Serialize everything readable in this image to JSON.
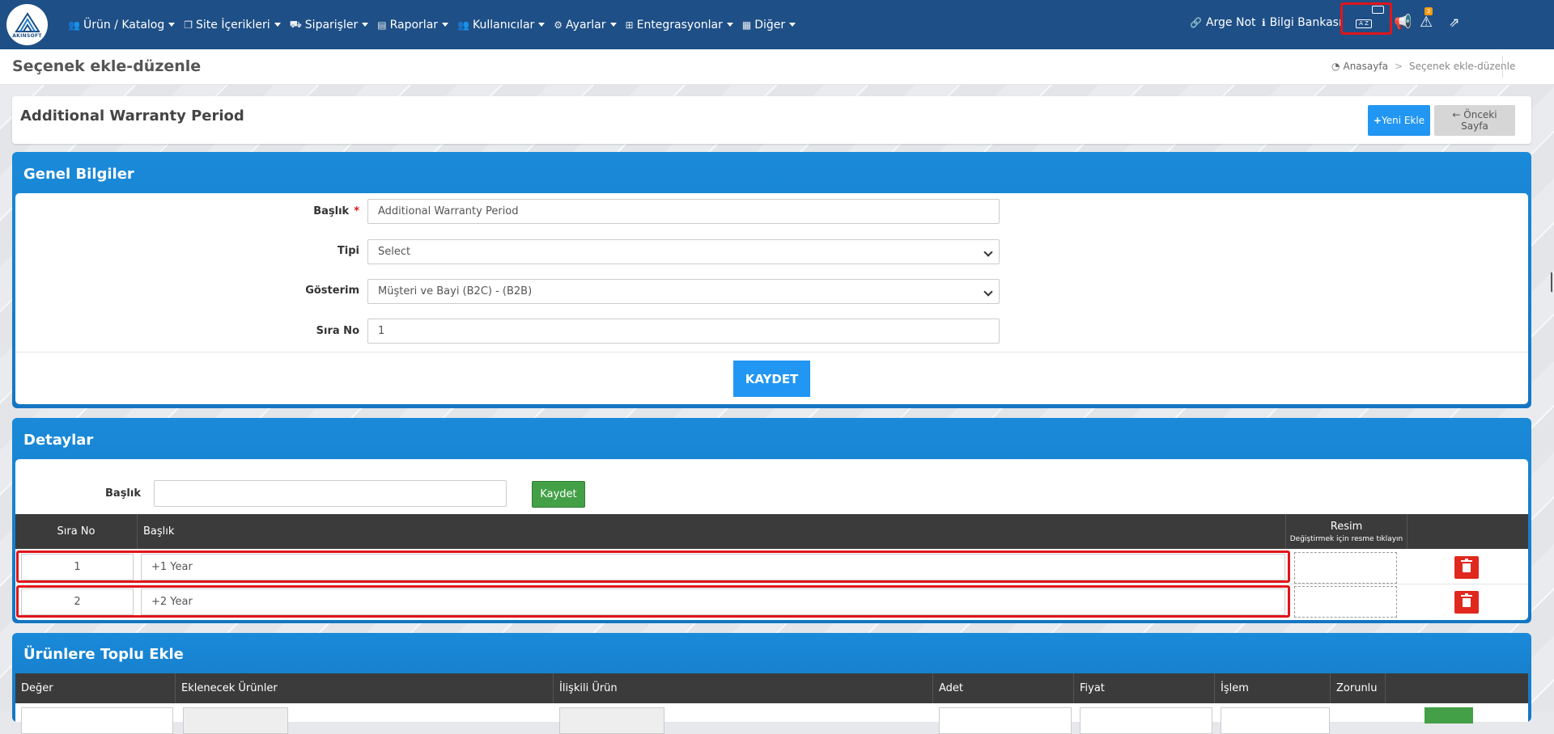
{
  "nav": {
    "logo_text": "AKINSOFT",
    "menu": [
      {
        "label": "Ürün / Katalog",
        "icon": "users-icon"
      },
      {
        "label": "Site İçerikleri",
        "icon": "copy-icon"
      },
      {
        "label": "Siparişler",
        "icon": "truck-icon"
      },
      {
        "label": "Raporlar",
        "icon": "file-icon"
      },
      {
        "label": "Kullanıcılar",
        "icon": "users-icon"
      },
      {
        "label": "Ayarlar",
        "icon": "gears-icon"
      },
      {
        "label": "Entegrasyonlar",
        "icon": "sitemap-icon"
      },
      {
        "label": "Diğer",
        "icon": "grid-icon"
      }
    ],
    "arge_not": "Arge Not",
    "bilgi_bankasi": "Bilgi Bankası",
    "keyboard_label": "A  Z",
    "alert_count": "3"
  },
  "header": {
    "page_title": "Seçenek ekle-düzenle",
    "breadcrumb_home": "Anasayfa",
    "breadcrumb_current": "Seçenek ekle-düzenle"
  },
  "title_card": {
    "title": "Additional Warranty Period",
    "new_label": "Yeni Ekle",
    "prev_label": "Önceki Sayfa"
  },
  "general": {
    "panel_title": "Genel Bilgiler",
    "baslik_label": "Başlık",
    "baslik_value": "Additional Warranty Period",
    "tipi_label": "Tipi",
    "tipi_value": "Select",
    "gosterim_label": "Gösterim",
    "gosterim_value": "Müşteri ve Bayi (B2C) - (B2B)",
    "sira_label": "Sıra No",
    "sira_value": "1",
    "save_label": "KAYDET"
  },
  "details": {
    "panel_title": "Detaylar",
    "baslik_label": "Başlık",
    "baslik_value": "",
    "save_label": "Kaydet",
    "col_sira": "Sıra No",
    "col_baslik": "Başlık",
    "col_resim": "Resim",
    "col_resim_hint": "Değiştirmek için resme tıklayın",
    "rows": [
      {
        "sira": "1",
        "baslik": "+1 Year"
      },
      {
        "sira": "2",
        "baslik": "+2 Year"
      }
    ]
  },
  "bulk": {
    "panel_title": "Ürünlere Toplu Ekle",
    "columns": [
      "Değer",
      "Eklenecek Ürünler",
      "İlişkili Ürün",
      "Adet",
      "Fiyat",
      "İşlem",
      "Zorunlu"
    ]
  },
  "colors": {
    "navbar": "#1e4f86",
    "panel": "#1a84d4",
    "primary_button": "#2196f3",
    "success_button": "#43a047",
    "danger_button": "#e0281e",
    "highlight": "#e0151b"
  }
}
